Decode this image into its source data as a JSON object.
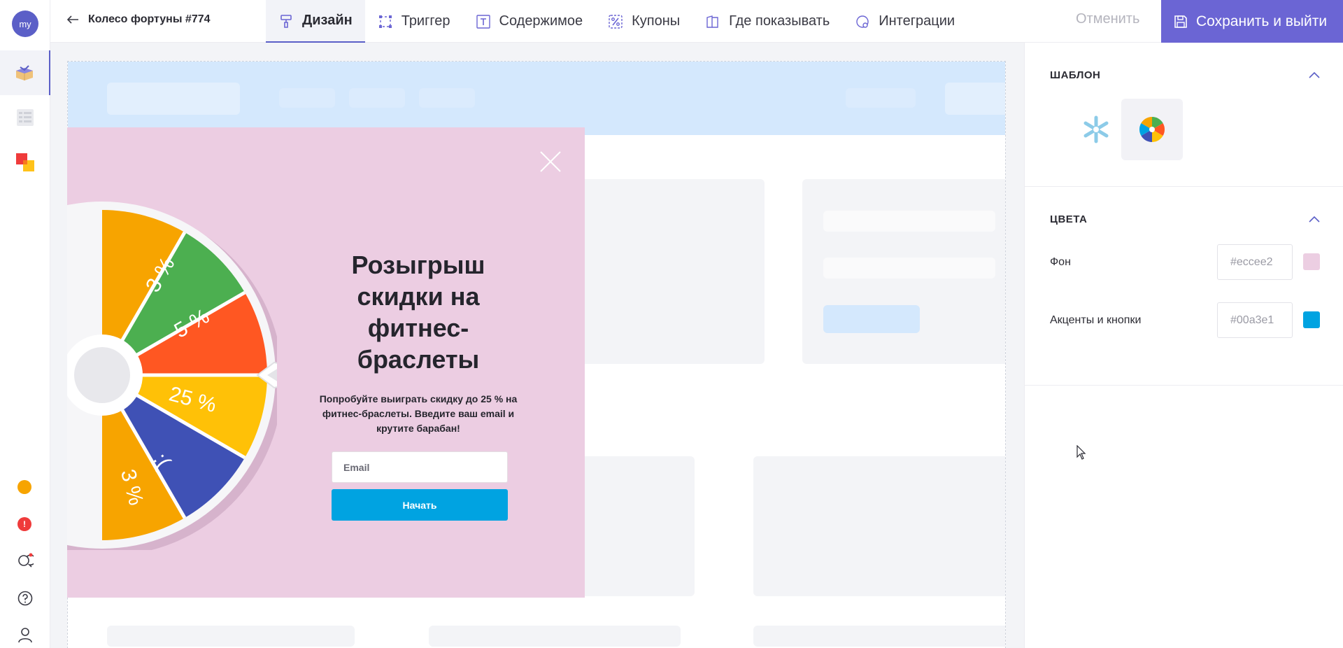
{
  "user": {
    "avatar_text": "my"
  },
  "rail": {
    "items": [
      {
        "icon": "gift-box-icon"
      },
      {
        "icon": "list-icon"
      },
      {
        "icon": "layers-icon"
      }
    ],
    "bottom": [
      {
        "icon": "coin-icon",
        "color": "#f7a400"
      },
      {
        "icon": "alert-icon",
        "color": "#ef3b3b"
      },
      {
        "icon": "chat-icon"
      },
      {
        "icon": "help-icon"
      },
      {
        "icon": "user-icon"
      }
    ]
  },
  "header": {
    "back_icon": "arrow-left-icon",
    "campaign_title": "Колесо фортуны #774",
    "tabs": [
      {
        "label": "Дизайн",
        "icon": "brush-icon",
        "active": true
      },
      {
        "label": "Триггер",
        "icon": "frame-icon",
        "active": false
      },
      {
        "label": "Содержимое",
        "icon": "text-icon",
        "active": false
      },
      {
        "label": "Купоны",
        "icon": "percent-icon",
        "active": false
      },
      {
        "label": "Где показывать",
        "icon": "pages-icon",
        "active": false
      },
      {
        "label": "Интеграции",
        "icon": "integration-icon",
        "active": false
      }
    ],
    "cancel_label": "Отменить",
    "save_label": "Сохранить и выйти",
    "accent": "#6b65d4"
  },
  "popup": {
    "background": "#eccde2",
    "title": "Розыгрыш скидки на фитнес-браслеты",
    "subtitle": "Попробуйте выиграть скидку до 25 % на фитнес-браслеты. Введите ваш email и крутите барабан!",
    "email_placeholder": "Email",
    "button_label": "Начать",
    "wheel_segments": [
      "3 %",
      "5 %",
      "25 %",
      ":(",
      "3 %",
      ":("
    ]
  },
  "panel": {
    "template_section_title": "ШАБЛОН",
    "templates": [
      {
        "icon": "snowflake-icon",
        "selected": false
      },
      {
        "icon": "wheel-icon",
        "selected": true
      }
    ],
    "colors_section_title": "ЦВЕТА",
    "colors": [
      {
        "label": "Фон",
        "value": "#eccee2",
        "swatch": "#eccee2"
      },
      {
        "label": "Акценты и кнопки",
        "value": "#00a3e1",
        "swatch": "#00a3e1"
      }
    ]
  }
}
